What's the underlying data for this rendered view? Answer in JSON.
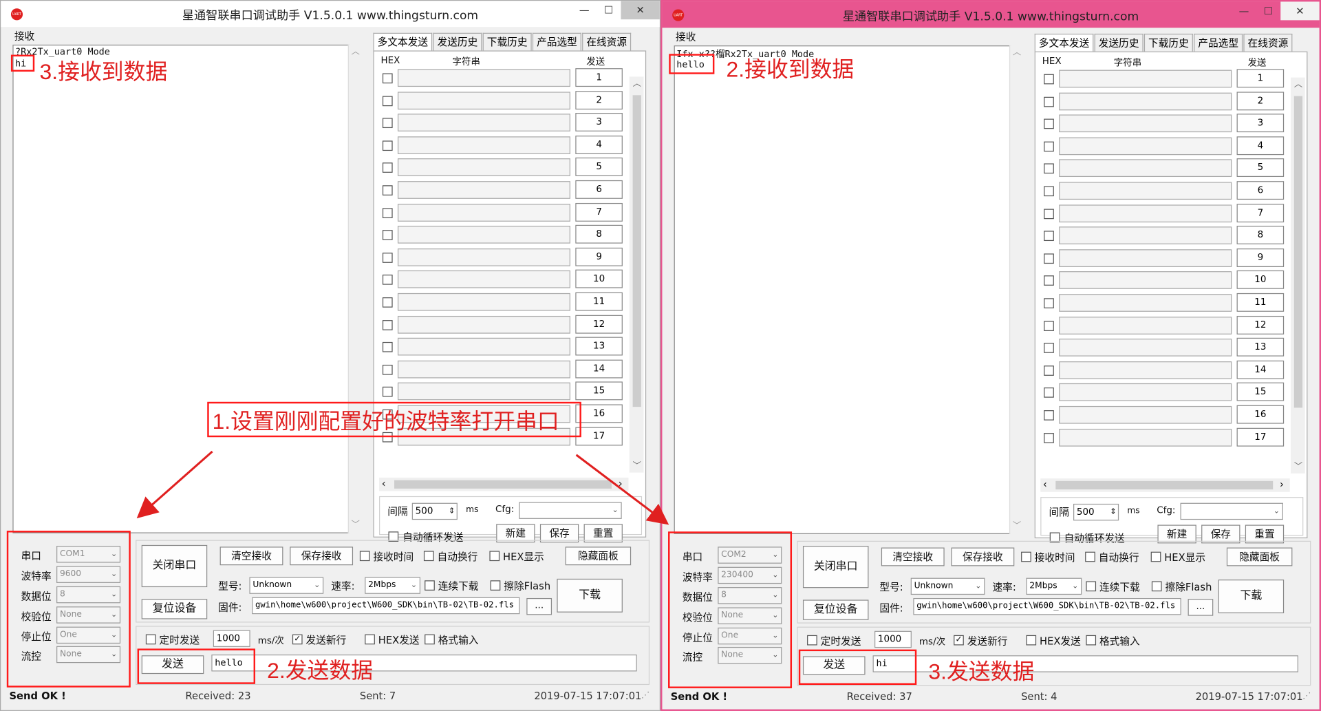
{
  "left": {
    "title": "星通智联串口调试助手 V1.5.0.1    www.thingsturn.com",
    "receive_label": "接收",
    "recv_lines": [
      "?Rx2Tx_uart0 Mode",
      "hi"
    ],
    "tabs": [
      "多文本发送",
      "发送历史",
      "下载历史",
      "产品选型",
      "在线资源"
    ],
    "grid_headers": {
      "hex": "HEX",
      "string": "字符串",
      "send": "发送"
    },
    "send_buttons": [
      "1",
      "2",
      "3",
      "4",
      "5",
      "6",
      "7",
      "8",
      "9",
      "10",
      "11",
      "12",
      "13",
      "14",
      "15",
      "16",
      "17"
    ],
    "interval_label": "间隔",
    "interval_value": "500",
    "ms_label": "ms",
    "cfg_label": "Cfg:",
    "auto_loop_label": "自动循环发送",
    "new_label": "新建",
    "save_label": "保存",
    "reset_label": "重置",
    "port_label": "串口",
    "port_value": "COM1",
    "baud_label": "波特率",
    "baud_value": "9600",
    "databits_label": "数据位",
    "databits_value": "8",
    "parity_label": "校验位",
    "parity_value": "None",
    "stopbits_label": "停止位",
    "stopbits_value": "One",
    "flow_label": "流控",
    "flow_value": "None",
    "close_port_label": "关闭串口",
    "reset_device_label": "复位设备",
    "clear_recv_label": "清空接收",
    "save_recv_label": "保存接收",
    "recv_time_label": "接收时间",
    "auto_wrap_label": "自动换行",
    "hex_display_label": "HEX显示",
    "hide_panel_label": "隐藏面板",
    "model_label": "型号:",
    "model_value": "Unknown",
    "rate_label": "速率:",
    "rate_value": "2Mbps",
    "cont_download_label": "连续下载",
    "erase_flash_label": "擦除Flash",
    "download_label": "下载",
    "firmware_label": "固件:",
    "firmware_value": "gwin\\home\\w600\\project\\W600_SDK\\bin\\TB-02\\TB-02.fls",
    "browse_label": "...",
    "timed_send_label": "定时发送",
    "timed_value": "1000",
    "ms_per_label": "ms/次",
    "send_newline_label": "发送新行",
    "hex_send_label": "HEX发送",
    "format_input_label": "格式输入",
    "send_label": "发送",
    "send_text": "hello",
    "status": "Send OK !",
    "received": "Received: 23",
    "sent": "Sent: 7",
    "datetime": "2019-07-15 17:07:01",
    "annotations": {
      "recv": "3.接收到数据",
      "config": "1.设置刚刚配置好的波特率打开串口",
      "send": "2.发送数据"
    }
  },
  "right": {
    "title": "星通智联串口调试助手 V1.5.0.1    www.thingsturn.com",
    "receive_label": "接收",
    "recv_lines": [
      "Ifx—x??榴Rx2Tx_uart0 Mode",
      "hello"
    ],
    "tabs": [
      "多文本发送",
      "发送历史",
      "下载历史",
      "产品选型",
      "在线资源"
    ],
    "grid_headers": {
      "hex": "HEX",
      "string": "字符串",
      "send": "发送"
    },
    "send_buttons": [
      "1",
      "2",
      "3",
      "4",
      "5",
      "6",
      "7",
      "8",
      "9",
      "10",
      "11",
      "12",
      "13",
      "14",
      "15",
      "16",
      "17"
    ],
    "interval_label": "间隔",
    "interval_value": "500",
    "ms_label": "ms",
    "cfg_label": "Cfg:",
    "auto_loop_label": "自动循环发送",
    "new_label": "新建",
    "save_label": "保存",
    "reset_label": "重置",
    "port_label": "串口",
    "port_value": "COM2",
    "baud_label": "波特率",
    "baud_value": "230400",
    "databits_label": "数据位",
    "databits_value": "8",
    "parity_label": "校验位",
    "parity_value": "None",
    "stopbits_label": "停止位",
    "stopbits_value": "One",
    "flow_label": "流控",
    "flow_value": "None",
    "close_port_label": "关闭串口",
    "reset_device_label": "复位设备",
    "clear_recv_label": "清空接收",
    "save_recv_label": "保存接收",
    "recv_time_label": "接收时间",
    "auto_wrap_label": "自动换行",
    "hex_display_label": "HEX显示",
    "hide_panel_label": "隐藏面板",
    "model_label": "型号:",
    "model_value": "Unknown",
    "rate_label": "速率:",
    "rate_value": "2Mbps",
    "cont_download_label": "连续下载",
    "erase_flash_label": "擦除Flash",
    "download_label": "下载",
    "firmware_label": "固件:",
    "firmware_value": "gwin\\home\\w600\\project\\W600_SDK\\bin\\TB-02\\TB-02.fls",
    "browse_label": "...",
    "timed_send_label": "定时发送",
    "timed_value": "1000",
    "ms_per_label": "ms/次",
    "send_newline_label": "发送新行",
    "hex_send_label": "HEX发送",
    "format_input_label": "格式输入",
    "send_label": "发送",
    "send_text": "hi",
    "status": "Send OK !",
    "received": "Received: 37",
    "sent": "Sent: 4",
    "datetime": "2019-07-15 17:07:01",
    "annotations": {
      "recv": "2.接收到数据",
      "send": "3.发送数据"
    }
  },
  "icons": {
    "app_icon_text": "UART",
    "minimize": "—",
    "maximize": "☐",
    "close": "✕",
    "scroll_up": "︿",
    "scroll_down": "﹀",
    "scroll_left": "‹",
    "scroll_right": "›",
    "dropdown": "⌄",
    "check": "✓",
    "spin": "⇕",
    "resize_grip": "⋰"
  },
  "colors": {
    "annotation_red": "#e02020",
    "right_window_frame": "#e8558f"
  }
}
